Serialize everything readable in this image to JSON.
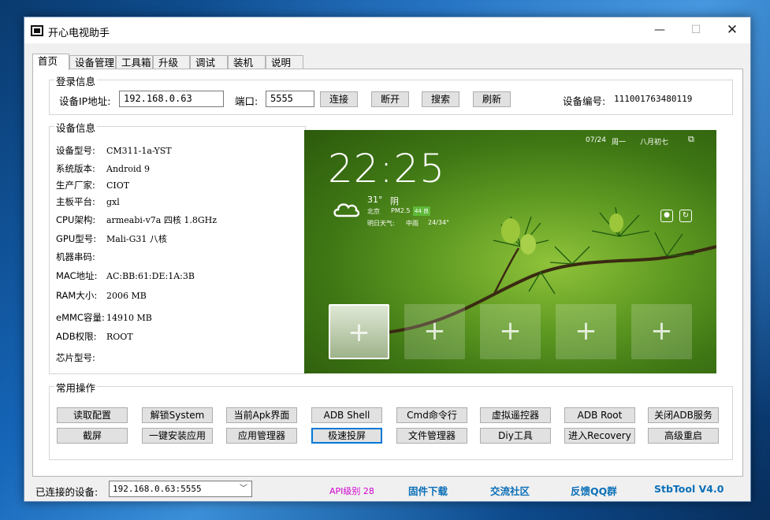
{
  "window": {
    "title": "开心电视助手",
    "controls": {
      "minimize": "—",
      "maximize": "☐",
      "close": "✕"
    }
  },
  "tabs": [
    "首页",
    "设备管理",
    "工具箱",
    "升级",
    "调试",
    "装机",
    "说明"
  ],
  "login": {
    "group_title": "登录信息",
    "ip_label": "设备IP地址:",
    "ip_value": "192.168.0.63",
    "port_label": "端口:",
    "port_value": "5555",
    "connect": "连接",
    "disconnect": "断开",
    "search": "搜索",
    "refresh": "刷新",
    "device_no_label": "设备编号:",
    "device_no_value": "111001763480119"
  },
  "device": {
    "group_title": "设备信息",
    "rows": [
      {
        "label": "设备型号:",
        "value": "CM311-1a-YST"
      },
      {
        "label": "系统版本:",
        "value": "Android 9"
      },
      {
        "label": "生产厂家:",
        "value": "CIOT"
      },
      {
        "label": "主板平台:",
        "value": "gxl"
      },
      {
        "label": "CPU架构:",
        "value": "armeabi-v7a 四核 1.8GHz"
      },
      {
        "label": "GPU型号:",
        "value": "Mali-G31 八核"
      },
      {
        "label": "机器串码:",
        "value": ""
      },
      {
        "label": "MAC地址:",
        "value": "AC:BB:61:DE:1A:3B"
      },
      {
        "label": "RAM大小:",
        "value": "2006 MB"
      },
      {
        "label": "eMMC容量:",
        "value": "14910 MB"
      },
      {
        "label": "ADB权限:",
        "value": "ROOT"
      },
      {
        "label": "芯片型号:",
        "value": ""
      }
    ]
  },
  "screen": {
    "date": "07/24",
    "weekday": "周一",
    "lunar": "八月初七",
    "time": "22:25",
    "temp": "31°",
    "weather": "阴",
    "city": "北京",
    "pm_label": "PM2.5",
    "pm_value": "44 良",
    "tomorrow_label": "明日天气:",
    "tomorrow_weather": "中雨",
    "tomorrow_temp": "24/34°",
    "tiles": [
      "+",
      "+",
      "+",
      "+",
      "+"
    ]
  },
  "ops": {
    "group_title": "常用操作",
    "row1": [
      "读取配置",
      "解锁System",
      "当前Apk界面",
      "ADB Shell",
      "Cmd命令行",
      "虚拟遥控器",
      "ADB  Root",
      "关闭ADB服务"
    ],
    "row2": [
      "截屏",
      "一键安装应用",
      "应用管理器",
      "极速投屏",
      "文件管理器",
      "Diy工具",
      "进入Recovery",
      "高级重启"
    ]
  },
  "status": {
    "connected_label": "已连接的设备:",
    "connected_value": "192.168.0.63:5555",
    "api_level": "API级别 28",
    "firmware": "固件下载",
    "community": "交流社区",
    "feedback": "反馈QQ群",
    "version": "StbTool V4.0"
  },
  "colors": {
    "link_blue": "#0b6fb8",
    "api_magenta": "#d000d0",
    "focus_blue": "#0078d7"
  }
}
